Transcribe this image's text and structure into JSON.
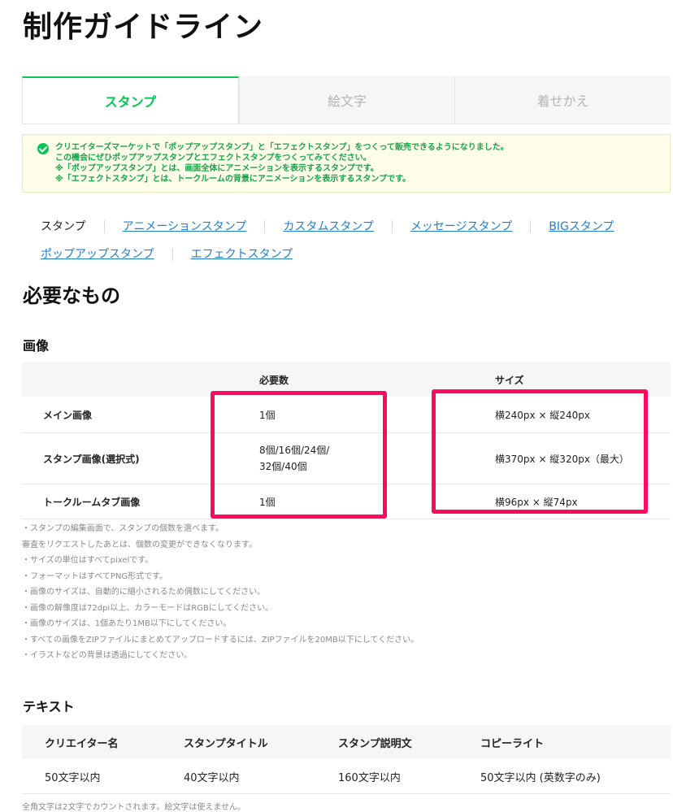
{
  "page_title": "制作ガイドライン",
  "tabs": [
    {
      "label": "スタンプ",
      "active": true
    },
    {
      "label": "絵文字",
      "active": false
    },
    {
      "label": "着せかえ",
      "active": false
    }
  ],
  "notice": {
    "lines": [
      "クリエイターズマーケットで「ポップアップスタンプ」と「エフェクトスタンプ」をつくって販売できるようになりました。",
      "この機会にぜひポップアップスタンプとエフェクトスタンプをつくってみてください。",
      "※「ポップアップスタンプ」とは、画面全体にアニメーションを表示するスタンプです。",
      "※「エフェクトスタンプ」とは、トークルームの背景にアニメーションを表示するスタンプです。"
    ]
  },
  "subnav": {
    "current": "スタンプ",
    "row1": [
      "アニメーションスタンプ",
      "カスタムスタンプ",
      "メッセージスタンプ",
      "BIGスタンプ"
    ],
    "row2": [
      "ポップアップスタンプ",
      "エフェクトスタンプ"
    ]
  },
  "section_title": "必要なもの",
  "images": {
    "heading": "画像",
    "columns": [
      "",
      "必要数",
      "サイズ"
    ],
    "rows": [
      {
        "label": "メイン画像",
        "count": "1個",
        "size": "横240px × 縦240px"
      },
      {
        "label": "スタンプ画像(選択式)",
        "count_line1": "8個/16個/24個/",
        "count_line2": "32個/40個",
        "size": "横370px × 縦320px（最大）"
      },
      {
        "label": "トークルームタブ画像",
        "count": "1個",
        "size": "横96px × 縦74px"
      }
    ],
    "notes": [
      "・スタンプの編集画面で、スタンプの個数を選べます。",
      "審査をリクエストしたあとは、個数の変更ができなくなります。",
      "・サイズの単位はすべてpixelです。",
      "・フォーマットはすべてPNG形式です。",
      "・画像のサイズは、自動的に縮小されるため偶数にしてください。",
      "・画像の解像度は72dpi以上、カラーモードはRGBにしてください。",
      "・画像のサイズは、1個あたり1MB以下にしてください。",
      "・すべての画像をZIPファイルにまとめてアップロードするには、ZIPファイルを20MB以下にしてください。",
      "・イラストなどの背景は透過にしてください。"
    ]
  },
  "text": {
    "heading": "テキスト",
    "columns": [
      "クリエイター名",
      "スタンプタイトル",
      "スタンプ説明文",
      "コピーライト"
    ],
    "values": [
      "50文字以内",
      "40文字以内",
      "160文字以内",
      "50文字以内 (英数字のみ)"
    ],
    "footnote": "全角文字は2文字でカウントされます。絵文字は使えません。"
  },
  "colors": {
    "accent": "#06c755",
    "link": "#1f7fd1",
    "highlight": "#ff0a5e"
  }
}
